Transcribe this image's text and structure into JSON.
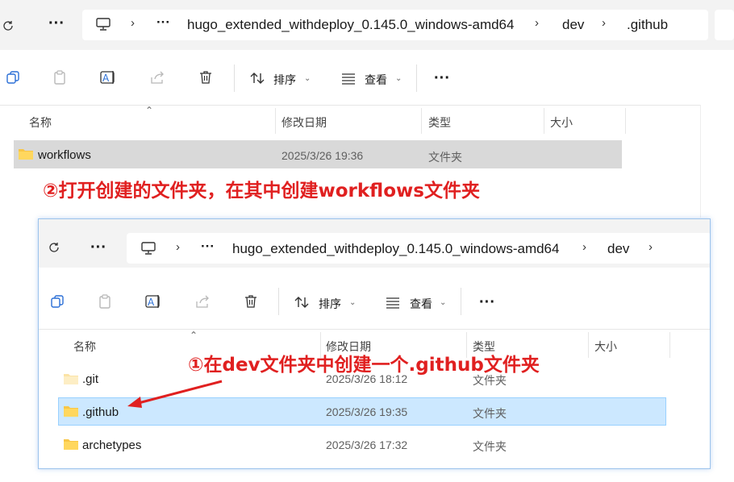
{
  "back_window": {
    "breadcrumb": [
      "hugo_extended_withdeploy_0.145.0_windows-amd64",
      "dev",
      ".github"
    ],
    "ellipsis": "···",
    "more": "···",
    "toolbar": {
      "sort_label": "排序",
      "view_label": "查看",
      "more": "···"
    },
    "columns": {
      "name": "名称",
      "modified": "修改日期",
      "type": "类型",
      "size": "大小"
    },
    "rows": [
      {
        "name": "workflows",
        "modified": "2025/3/26 19:36",
        "type": "文件夹"
      }
    ]
  },
  "annotation_2": "②打开创建的文件夹，在其中创建workflows文件夹",
  "front_window": {
    "breadcrumb": [
      "hugo_extended_withdeploy_0.145.0_windows-amd64",
      "dev"
    ],
    "ellipsis": "···",
    "more": "···",
    "toolbar": {
      "sort_label": "排序",
      "view_label": "查看",
      "more": "···"
    },
    "columns": {
      "name": "名称",
      "modified": "修改日期",
      "type": "类型",
      "size": "大小"
    },
    "rows": [
      {
        "name": ".git",
        "modified": "2025/3/26 18:12",
        "type": "文件夹"
      },
      {
        "name": ".github",
        "modified": "2025/3/26 19:35",
        "type": "文件夹"
      },
      {
        "name": "archetypes",
        "modified": "2025/3/26 17:32",
        "type": "文件夹"
      }
    ]
  },
  "annotation_1": "①在dev文件夹中创建一个.github文件夹",
  "colors": {
    "annotation": "#e02020",
    "selected_row": "#cce8ff",
    "selected_border": "#99d1ff",
    "folder": "#f8c646"
  }
}
